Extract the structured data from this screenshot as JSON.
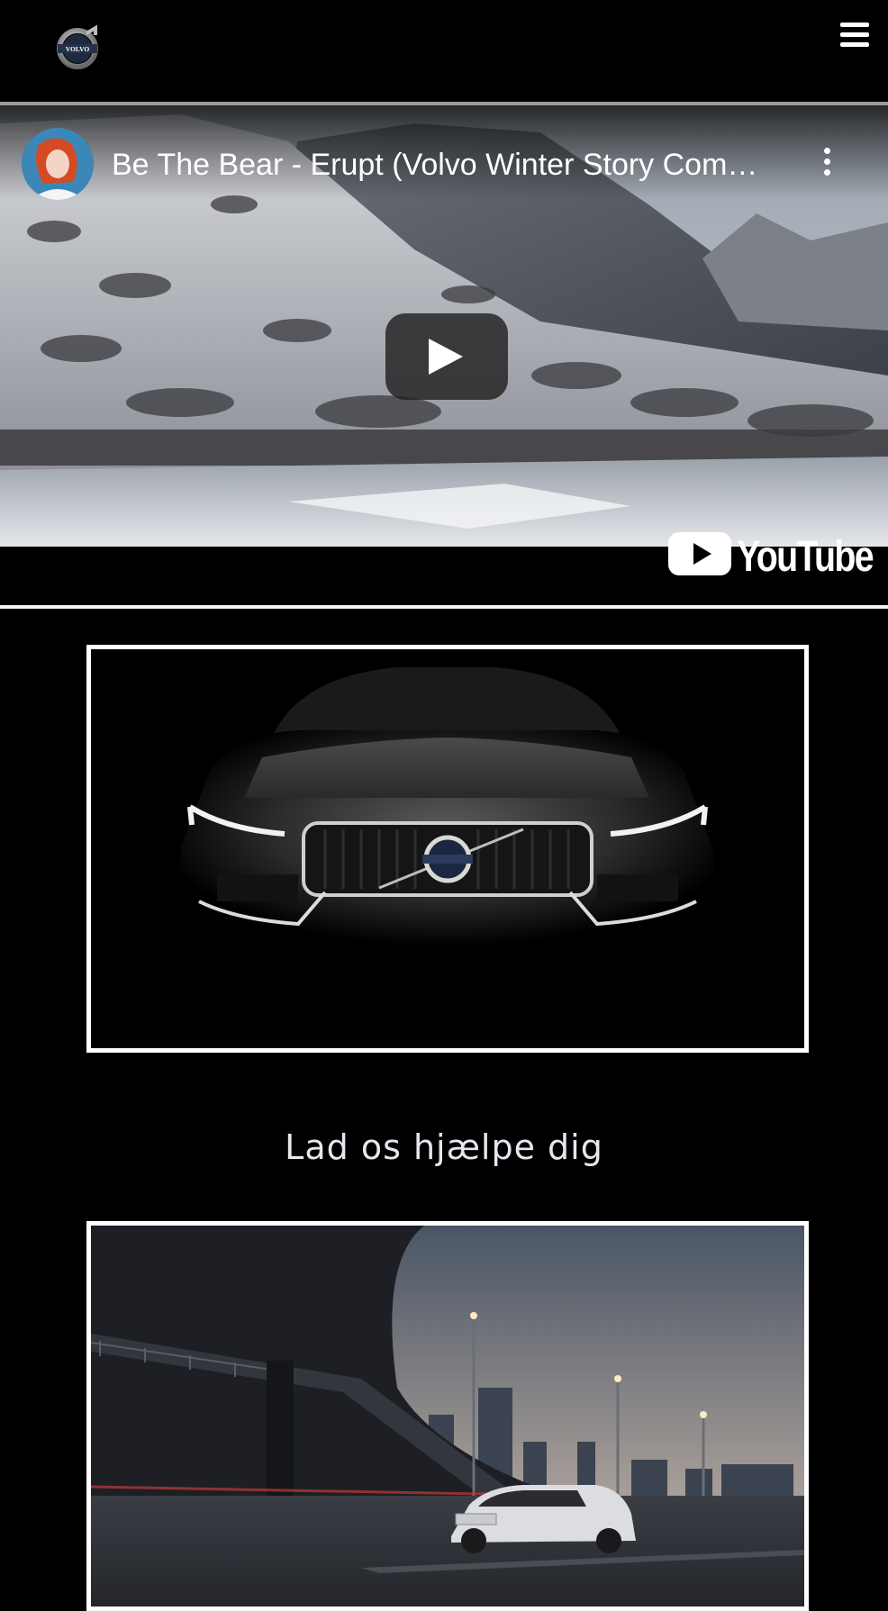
{
  "header": {
    "logo_icon": "volvo-logo-icon",
    "logo_text": "VOLVO",
    "menu_icon": "hamburger-menu-icon"
  },
  "video": {
    "title": "Be The Bear - Erupt (Volvo Winter Story Commercial)",
    "channel_avatar_icon": "channel-avatar",
    "more_icon": "more-vertical-icon",
    "play_icon": "play-icon",
    "youtube_logo_text": "YouTube"
  },
  "main": {
    "hero_car_alt": "volvo-car-front-image",
    "heading": "Lad os hjælpe dig",
    "city_car_alt": "volvo-suv-city-image"
  },
  "colors": {
    "background": "#000000",
    "text": "#ffffff",
    "heading": "#e6e6ee",
    "divider": "#9a9a9a",
    "card_border": "#ffffff"
  }
}
